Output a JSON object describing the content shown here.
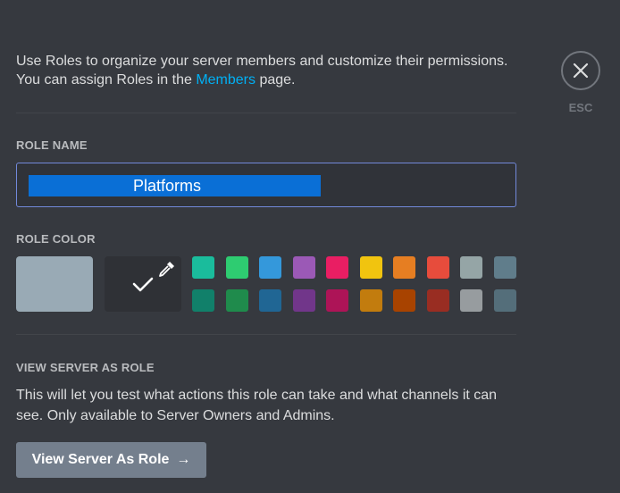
{
  "intro": {
    "text_before": "Use Roles to organize your server members and customize their permissions. You can assign Roles in the ",
    "link": "Members",
    "text_after": " page."
  },
  "close": {
    "label": "ESC",
    "icon": "close-icon"
  },
  "role_name": {
    "label": "ROLE NAME",
    "value": "Platforms"
  },
  "role_color": {
    "label": "ROLE COLOR",
    "default_color": "#99aab5",
    "custom_color": "#2f3136",
    "swatches_row1": [
      "#1abc9c",
      "#2ecc71",
      "#3498db",
      "#9b59b6",
      "#e91e63",
      "#f1c40f",
      "#e67e22",
      "#e74c3c",
      "#95a5a6",
      "#607d8b"
    ],
    "swatches_row2": [
      "#11806a",
      "#1f8b4c",
      "#206694",
      "#71368a",
      "#ad1457",
      "#c27c0e",
      "#a84300",
      "#992d22",
      "#979c9f",
      "#546e7a"
    ]
  },
  "view_as_role": {
    "label": "VIEW SERVER AS ROLE",
    "description": "This will let you test what actions this role can take and what channels it can see. Only available to Server Owners and Admins.",
    "button": "View Server As Role",
    "button_arrow": "→"
  }
}
